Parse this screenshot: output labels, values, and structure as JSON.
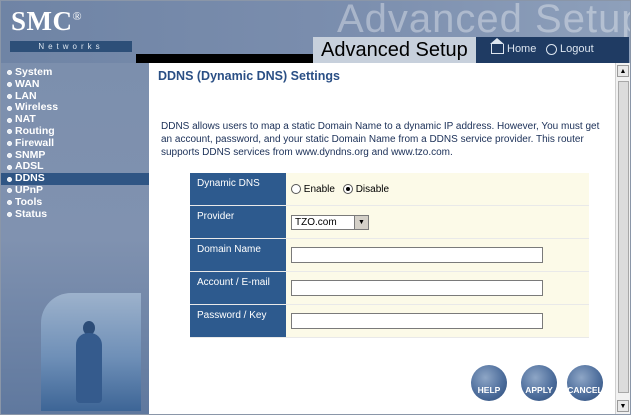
{
  "header": {
    "logo": "SMC",
    "logo_mark": "®",
    "logo_sub": "Networks",
    "ghost_text": "Advanced Setup",
    "title": "Advanced Setup",
    "home_label": "Home",
    "logout_label": "Logout"
  },
  "sidebar": {
    "items": [
      {
        "label": "System"
      },
      {
        "label": "WAN"
      },
      {
        "label": "LAN"
      },
      {
        "label": "Wireless"
      },
      {
        "label": "NAT"
      },
      {
        "label": "Routing"
      },
      {
        "label": "Firewall"
      },
      {
        "label": "SNMP"
      },
      {
        "label": "ADSL"
      },
      {
        "label": "DDNS"
      },
      {
        "label": "UPnP"
      },
      {
        "label": "Tools"
      },
      {
        "label": "Status"
      }
    ],
    "active": "DDNS"
  },
  "main": {
    "title": "DDNS (Dynamic DNS) Settings",
    "description": "DDNS allows users to map a static Domain Name to a dynamic IP address. However, You must get an account, password, and your static Domain Name from a DDNS service provider. This router supports DDNS services from www.dyndns.org and www.tzo.com.",
    "form": {
      "dynamic_dns_label": "Dynamic DNS",
      "enable_label": "Enable",
      "disable_label": "Disable",
      "selected": "Disable",
      "provider_label": "Provider",
      "provider_value": "TZO.com",
      "domain_label": "Domain Name",
      "domain_value": "",
      "account_label": "Account / E-mail",
      "account_value": "",
      "password_label": "Password / Key",
      "password_value": ""
    },
    "buttons": {
      "help": "HELP",
      "apply": "APPLY",
      "cancel": "CANCEL"
    }
  },
  "colors": {
    "header": "#7b8eae",
    "title_bar": "#1f3b63",
    "sidebar": "#8092b0",
    "active_item": "#2f5584",
    "label_cell": "#2d5a8e",
    "value_cell": "#fcfae8",
    "title_text": "#2a4f85"
  }
}
